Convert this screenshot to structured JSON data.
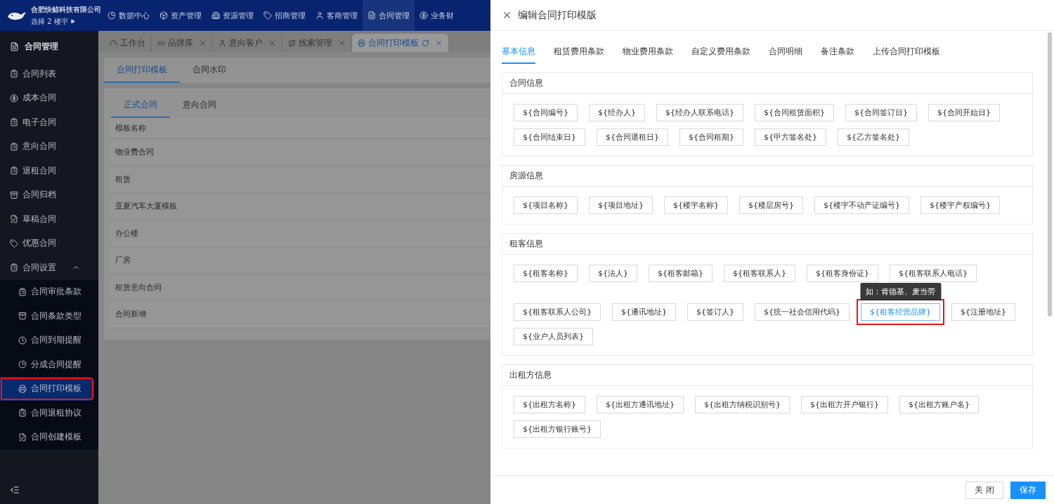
{
  "app": {
    "company": "合肥快鲸科技有限公司",
    "building_selector": "选择 2 楼宇",
    "top_nav": [
      {
        "label": "数据中心",
        "kind": "chart",
        "selected": false
      },
      {
        "label": "资产管理",
        "kind": "box",
        "selected": false
      },
      {
        "label": "资源管理",
        "kind": "building",
        "selected": false
      },
      {
        "label": "招商管理",
        "kind": "tag",
        "selected": false
      },
      {
        "label": "客商管理",
        "kind": "user",
        "selected": false
      },
      {
        "label": "合同管理",
        "kind": "file",
        "selected": true
      },
      {
        "label": "业务财",
        "kind": "coin",
        "selected": false
      }
    ],
    "sidebar": {
      "title": "合同管理",
      "items": [
        {
          "label": "合同列表",
          "kind": "list",
          "selected": false,
          "highlighted": false
        },
        {
          "label": "成本合同",
          "kind": "coin",
          "selected": false,
          "highlighted": false
        },
        {
          "label": "电子合同",
          "kind": "list",
          "selected": false,
          "highlighted": false
        },
        {
          "label": "意向合同",
          "kind": "list",
          "selected": false,
          "highlighted": false
        },
        {
          "label": "退租合同",
          "kind": "list",
          "selected": false,
          "highlighted": false
        },
        {
          "label": "合同归档",
          "kind": "archive",
          "selected": false,
          "highlighted": false
        },
        {
          "label": "草稿合同",
          "kind": "draft",
          "selected": false,
          "highlighted": false
        },
        {
          "label": "优惠合同",
          "kind": "tag",
          "selected": false,
          "highlighted": false
        },
        {
          "label": "合同设置",
          "kind": "list",
          "selected": false,
          "highlighted": false,
          "expanded": true,
          "children": [
            {
              "label": "合同审批条款",
              "kind": "list",
              "selected": false,
              "highlighted": false
            },
            {
              "label": "合同条款类型",
              "kind": "archive",
              "selected": false,
              "highlighted": false
            },
            {
              "label": "合同到期提醒",
              "kind": "clock",
              "selected": false,
              "highlighted": false
            },
            {
              "label": "分成合同提醒",
              "kind": "pie",
              "selected": false,
              "highlighted": false
            },
            {
              "label": "合同打印模板",
              "kind": "printer",
              "selected": true,
              "highlighted": true
            },
            {
              "label": "合同退租协议",
              "kind": "list",
              "selected": false,
              "highlighted": false
            },
            {
              "label": "合同创建模板",
              "kind": "draft",
              "selected": false,
              "highlighted": false
            }
          ]
        }
      ]
    },
    "page_tabs": [
      {
        "label": "工作台",
        "kind": "gauge",
        "selected": false,
        "closable": false
      },
      {
        "label": "品牌库",
        "kind": "link",
        "selected": false,
        "closable": true
      },
      {
        "label": "意向客户",
        "kind": "user",
        "selected": false,
        "closable": true
      },
      {
        "label": "线索管理",
        "kind": "route",
        "selected": false,
        "closable": true
      },
      {
        "label": "合同打印模板",
        "kind": "printer",
        "selected": true,
        "closable": true
      }
    ],
    "sub_tabs": [
      {
        "label": "合同打印模板",
        "selected": true
      },
      {
        "label": "合同水印",
        "selected": false
      }
    ],
    "inner_tabs": [
      {
        "label": "正式合同",
        "selected": true
      },
      {
        "label": "意向合同",
        "selected": false
      }
    ],
    "table": {
      "columns": [
        "模板名称"
      ],
      "rows": [
        "物业费合同",
        "租赁",
        "亚夏汽车大厦模板",
        "办公楼",
        "厂房",
        "租赁意向合同",
        "合同新增"
      ]
    }
  },
  "drawer": {
    "title": "编辑合同打印模版",
    "tabs": [
      {
        "label": "基本信息",
        "selected": true
      },
      {
        "label": "租赁费用条款",
        "selected": false
      },
      {
        "label": "物业费用条款",
        "selected": false
      },
      {
        "label": "自定义费用条款",
        "selected": false
      },
      {
        "label": "合同明细",
        "selected": false
      },
      {
        "label": "备注条款",
        "selected": false
      },
      {
        "label": "上传合同打印模板",
        "selected": false
      }
    ],
    "sections": [
      {
        "title": "合同信息",
        "rows": [
          [
            {
              "label": "${合同编号}"
            },
            {
              "label": "${经办人}"
            },
            {
              "label": "${经办人联系电话}"
            },
            {
              "label": "${合同租赁面积}"
            },
            {
              "label": "${合同签订日}"
            },
            {
              "label": "${合同开始日}"
            }
          ],
          [
            {
              "label": "${合同结束日}"
            },
            {
              "label": "${合同退租日}"
            },
            {
              "label": "${合同租期}"
            },
            {
              "label": "${甲方签名处}"
            },
            {
              "label": "${乙方签名处}"
            }
          ]
        ]
      },
      {
        "title": "房源信息",
        "rows": [
          [
            {
              "label": "${项目名称}"
            },
            {
              "label": "${项目地址}"
            },
            {
              "label": "${楼宇名称}"
            },
            {
              "label": "${楼层房号}"
            },
            {
              "label": "${楼宇不动产证编号}"
            },
            {
              "label": "${楼宇产权编号}"
            }
          ]
        ]
      },
      {
        "title": "租客信息",
        "rows": [
          [
            {
              "label": "${租客名称}"
            },
            {
              "label": "${法人}"
            },
            {
              "label": "${租客邮箱}"
            },
            {
              "label": "${租客联系人}"
            },
            {
              "label": "${租客身份证}"
            },
            {
              "label": "${租客联系人电话}"
            }
          ],
          [
            {
              "label": "${租客联系人公司}"
            },
            {
              "label": "${通讯地址}"
            },
            {
              "label": "${签订人}"
            },
            {
              "label": "${统一社会信用代码}"
            },
            {
              "label": "${租客经营品牌}",
              "selected": true,
              "highlighted": true,
              "tooltip": "如：肯德基、麦当劳"
            },
            {
              "label": "${注册地址}"
            }
          ],
          [
            {
              "label": "${业户人员列表}"
            }
          ]
        ]
      },
      {
        "title": "出租方信息",
        "rows": [
          [
            {
              "label": "${出租方名称}"
            },
            {
              "label": "${出租方通讯地址}"
            },
            {
              "label": "${出租方纳税识别号}"
            },
            {
              "label": "${出租方开户银行}"
            },
            {
              "label": "${出租方账户名}"
            }
          ],
          [
            {
              "label": "${出租方银行账号}"
            }
          ]
        ]
      }
    ],
    "buttons": [
      {
        "label": "关 闭",
        "kind": "secondary"
      },
      {
        "label": "保存",
        "kind": "primary"
      }
    ]
  }
}
